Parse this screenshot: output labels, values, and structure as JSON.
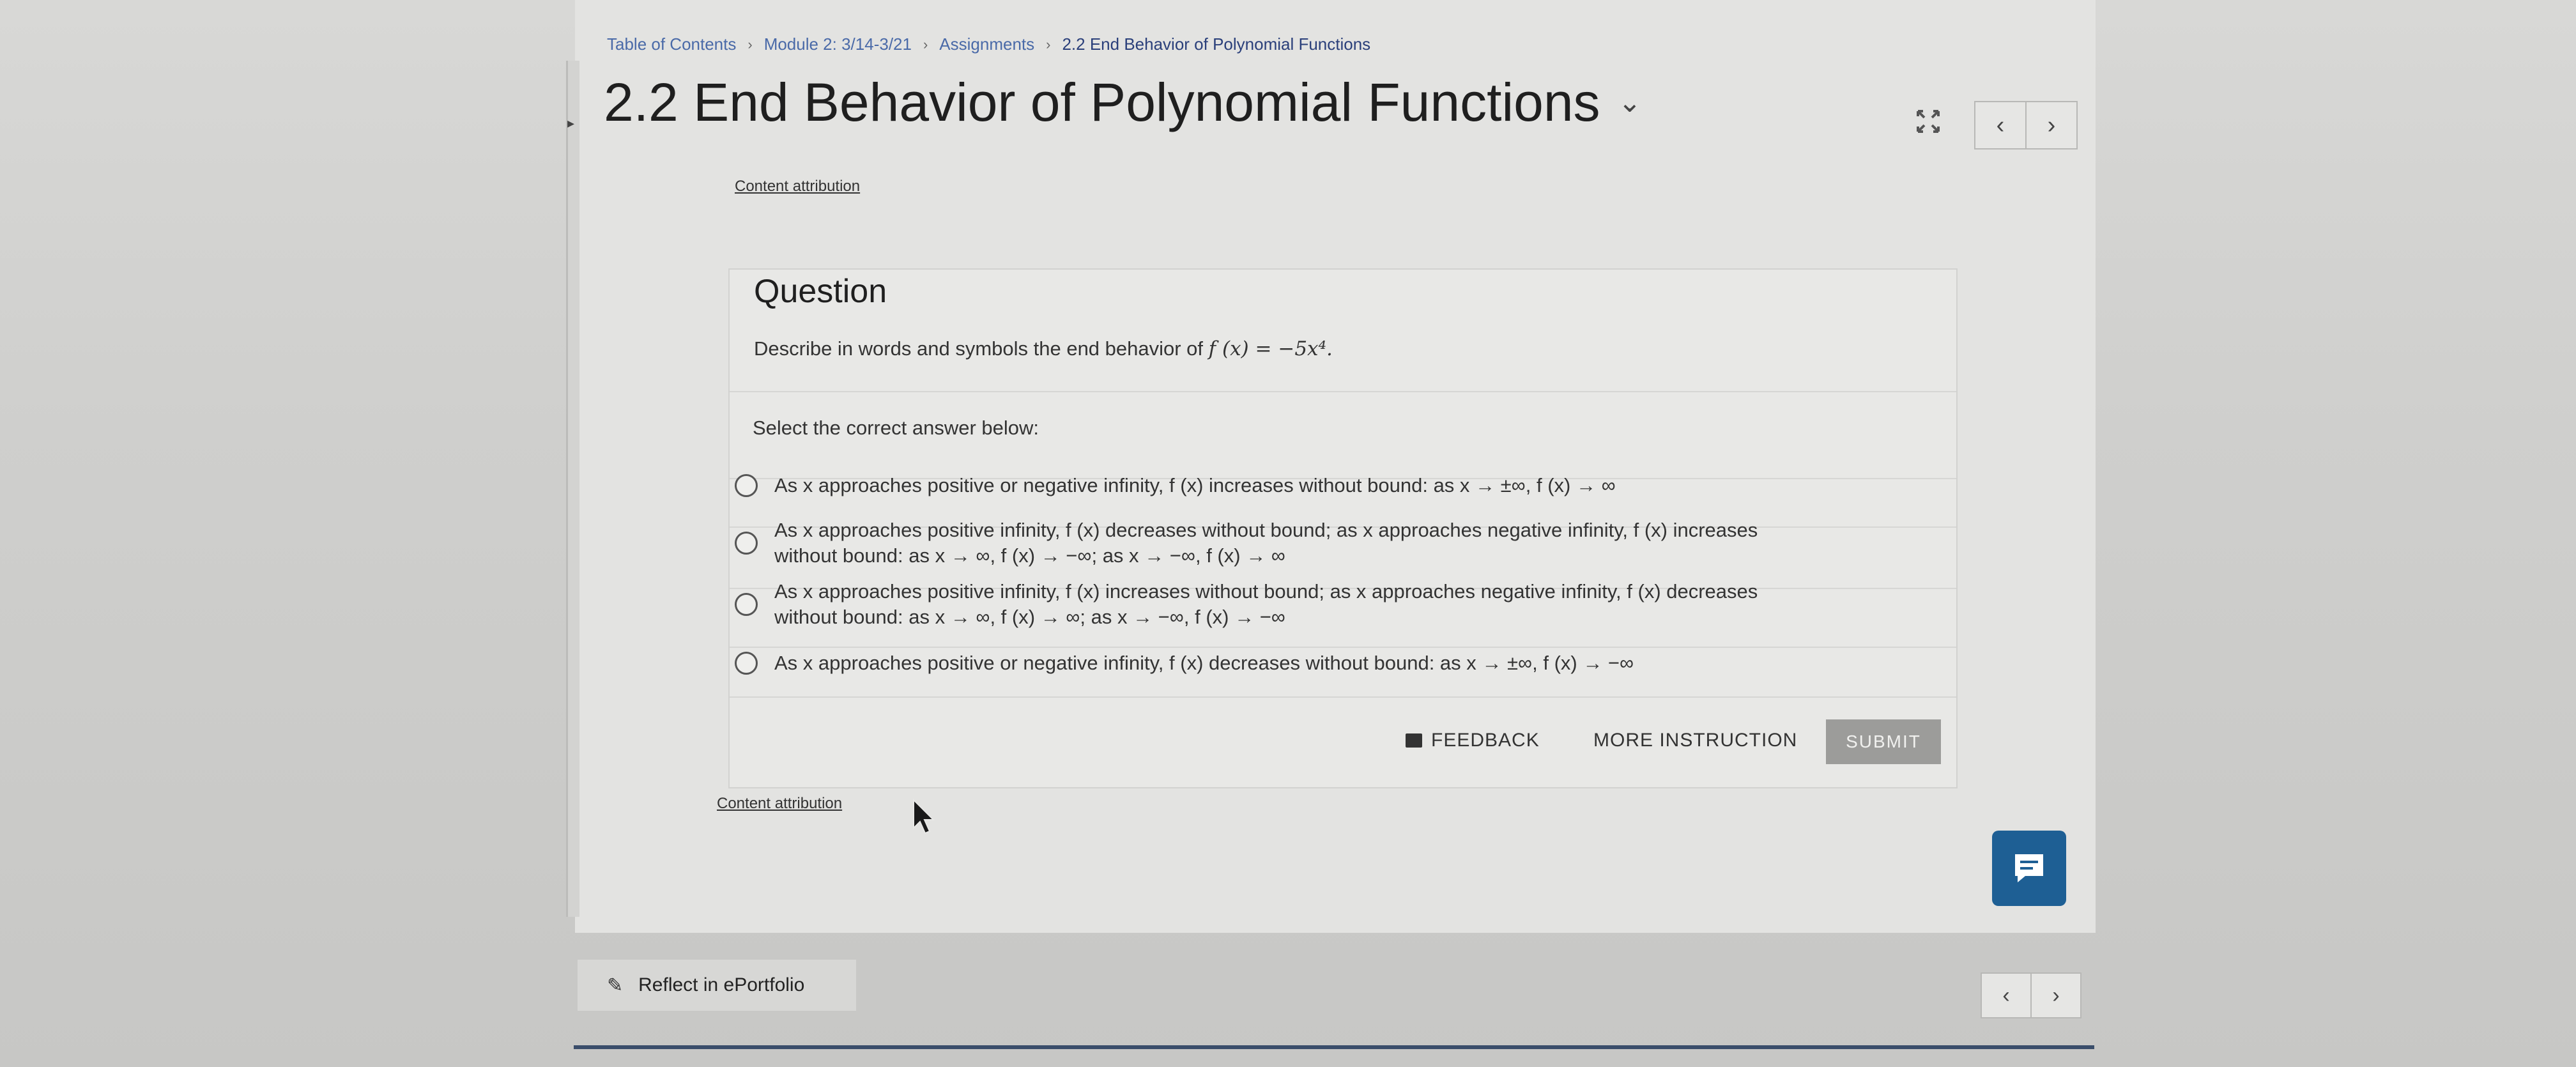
{
  "breadcrumb": {
    "items": [
      "Table of Contents",
      "Module 2: 3/14-3/21",
      "Assignments",
      "2.2 End Behavior of Polynomial Functions"
    ],
    "separator": "›"
  },
  "page": {
    "title": "2.2 End Behavior of Polynomial Functions",
    "title_chevron": "⌄",
    "attribution_top": "Content attribution",
    "attribution_bottom": "Content attribution"
  },
  "nav": {
    "prev": "‹",
    "next": "›"
  },
  "question": {
    "heading": "Question",
    "prompt_text": "Describe in words and symbols the end behavior of ",
    "prompt_math": "f (x) = −5x⁴.",
    "select_label": "Select the correct answer below:",
    "options": [
      {
        "text_a": "As x approaches positive or negative infinity, f (x) increases without bound: as x → ±∞,  f (x) → ∞",
        "text_b": ""
      },
      {
        "text_a": "As x approaches positive infinity, f (x) decreases without bound; as x approaches negative infinity, f (x) increases",
        "text_b": "without bound: as x → ∞,  f (x) → −∞;  as x → −∞,  f (x) → ∞"
      },
      {
        "text_a": "As x approaches positive infinity, f (x) increases without bound; as x approaches negative infinity, f (x) decreases",
        "text_b": "without bound: as x → ∞,  f (x) → ∞;  as x → −∞,  f (x) → −∞"
      },
      {
        "text_a": "As x approaches positive or negative infinity, f (x) decreases without bound: as x → ±∞,  f (x) → −∞",
        "text_b": ""
      }
    ]
  },
  "actions": {
    "feedback": "FEEDBACK",
    "more_instruction": "MORE INSTRUCTION",
    "submit": "SUBMIT"
  },
  "footer": {
    "reflect": "Reflect in ePortfolio"
  },
  "colors": {
    "link": "#4a6aa8",
    "chat_button": "#1e5f94",
    "submit_disabled": "#9c9c9a"
  }
}
